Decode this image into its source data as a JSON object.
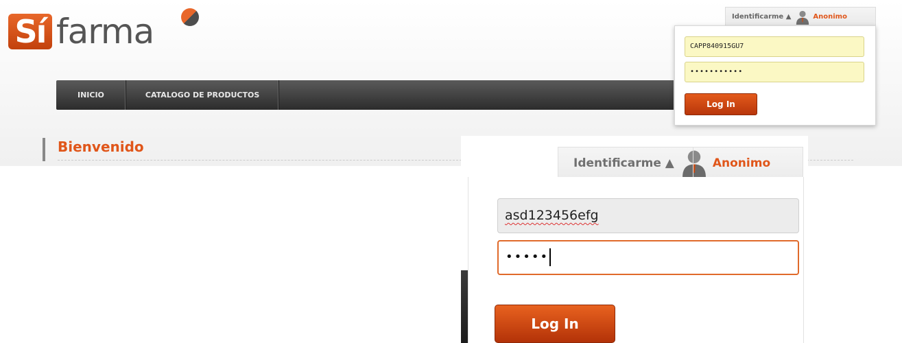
{
  "brand": {
    "logo_si": "Sí",
    "logo_farma": "farma",
    "accent_color": "#e0561a"
  },
  "nav": {
    "items": [
      {
        "label": "INICIO"
      },
      {
        "label": "CATALOGO DE PRODUCTOS"
      }
    ]
  },
  "main": {
    "heading": "Bienvenido"
  },
  "login_small": {
    "tab_label": "Identificarme ▲",
    "user_label": "Anonimo",
    "user_icon": "user-icon",
    "username_value": "CAPP840915GU7",
    "password_value": "•••••••••••",
    "button_label": "Log In"
  },
  "login_zoom": {
    "tab_label": "Identificarme ▲",
    "user_label": "Anonimo",
    "user_icon": "user-icon",
    "username_value": "asd123456efg",
    "password_value": "•••••",
    "button_label": "Log In"
  }
}
